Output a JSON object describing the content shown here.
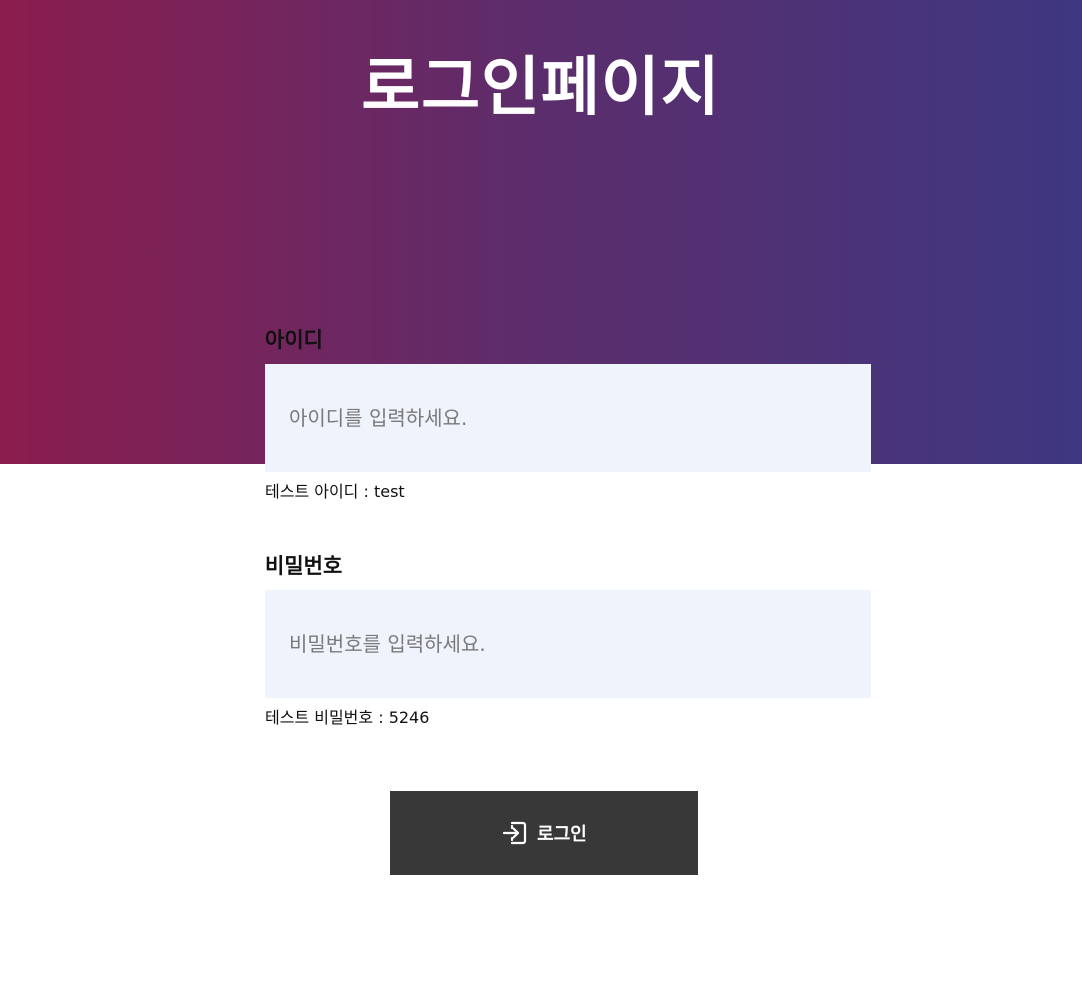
{
  "header": {
    "title": "로그인페이지"
  },
  "form": {
    "id_field": {
      "label": "아이디",
      "placeholder": "아이디를 입력하세요.",
      "value": "",
      "hint": "테스트 아이디 : test"
    },
    "password_field": {
      "label": "비밀번호",
      "placeholder": "비밀번호를 입력하세요.",
      "value": "",
      "hint": "테스트 비밀번호 : 5246"
    },
    "submit": {
      "label": "로그인",
      "icon": "login-icon"
    }
  },
  "colors": {
    "gradient_start": "#8b1d4e",
    "gradient_end": "#3e3781",
    "input_background": "#eff3fb",
    "button_background": "#383838"
  }
}
